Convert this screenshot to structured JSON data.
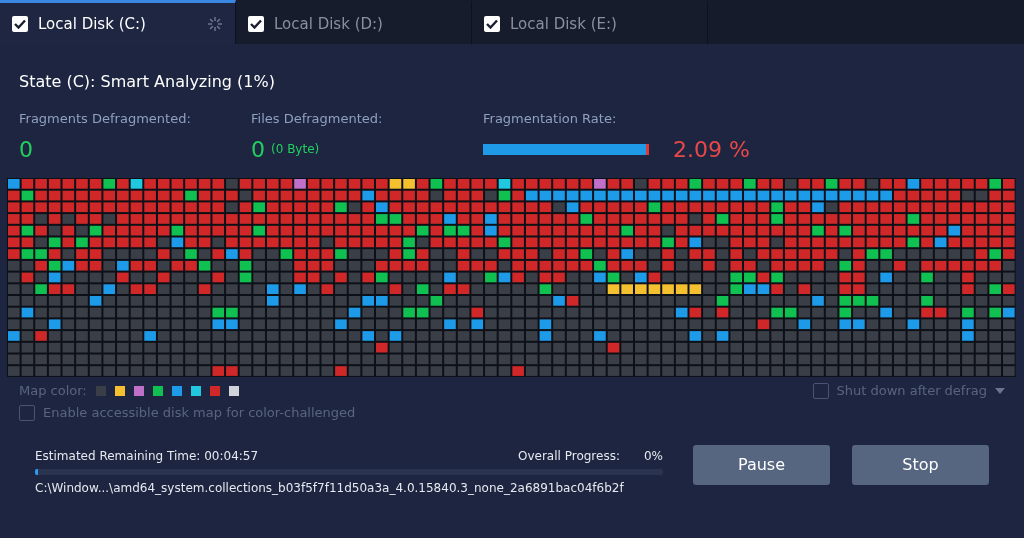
{
  "tabs": [
    {
      "label": "Local Disk (C:)",
      "checked": true,
      "selected": true,
      "busy": true
    },
    {
      "label": "Local Disk (D:)",
      "checked": true,
      "selected": false,
      "busy": false
    },
    {
      "label": "Local Disk (E:)",
      "checked": true,
      "selected": false,
      "busy": false
    }
  ],
  "state": "State (C): Smart Analyzing (1%)",
  "stats": [
    {
      "kind": "count",
      "label": "Fragments Defragmented:",
      "value": "0"
    },
    {
      "kind": "count",
      "label": "Files Defragmented:",
      "value": "0",
      "detail": "(0 Byte)"
    },
    {
      "kind": "rate",
      "label": "Fragmentation Rate:",
      "level": 0.979,
      "value": "2.09 %"
    }
  ],
  "legend": {
    "label": "Map color:",
    "colors": [
      {
        "color": "#3a3f47"
      },
      {
        "color": "#f5c030"
      },
      {
        "color": "#c070c8"
      },
      {
        "color": "#10c050"
      },
      {
        "color": "#1e9be8"
      },
      {
        "color": "#20c8e0"
      },
      {
        "color": "#d02828"
      },
      {
        "color": "#d0d4da"
      }
    ]
  },
  "accessible_map": {
    "label": "Enable accessible disk map for color-challenged",
    "checked": false
  },
  "shutdown": {
    "label": "Shut down after defrag",
    "checked": false
  },
  "progress": {
    "remaining": "Estimated Remaining Time: 00:04:57",
    "overall_label": "Overall Progress:",
    "overall_value": "0%",
    "level": 0.005,
    "current_file": "C:\\Window...\\amd64_system.collections_b03f5f7f11d50a3a_4.0.15840.3_none_2a6891bac04f6b2f"
  },
  "buttons": [
    "Pause",
    "Stop"
  ]
}
